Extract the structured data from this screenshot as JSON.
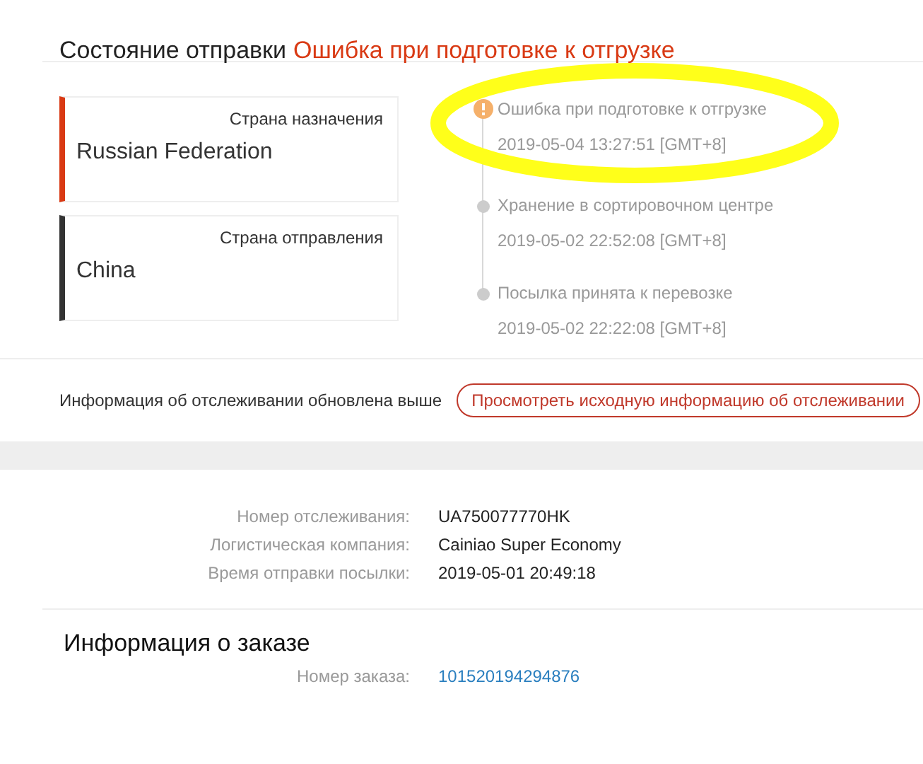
{
  "status": {
    "label": "Состояние отправки",
    "value": "Ошибка при подготовке к отгрузке"
  },
  "countries": [
    {
      "label": "Страна назначения",
      "value": "Russian Federation",
      "color": "#d93a14"
    },
    {
      "label": "Страна отправления",
      "value": "China",
      "color": "#333333"
    }
  ],
  "events": [
    {
      "kind": "error",
      "text": "Ошибка при подготовке к отгрузке",
      "time": "2019-05-04 13:27:51 [GMT+8]",
      "highlighted": true
    },
    {
      "kind": "normal",
      "text": "Хранение в сортировочном центре",
      "time": "2019-05-02 22:52:08 [GMT+8]",
      "highlighted": false
    },
    {
      "kind": "normal",
      "text": "Посылка принята к перевозке",
      "time": "2019-05-02 22:22:08 [GMT+8]",
      "highlighted": false
    }
  ],
  "update_note": "Информация об отслеживании обновлена выше",
  "source_button": "Просмотреть исходную информацию об отслеживании",
  "shipment": [
    {
      "label": "Номер отслеживания:",
      "value": "UA750077770HK"
    },
    {
      "label": "Логистическая компания:",
      "value": "Cainiao Super Economy"
    },
    {
      "label": "Время отправки посылки:",
      "value": "2019-05-01 20:49:18"
    }
  ],
  "order": {
    "title": "Информация о заказе",
    "label": "Номер заказа:",
    "number": "101520194294876"
  }
}
